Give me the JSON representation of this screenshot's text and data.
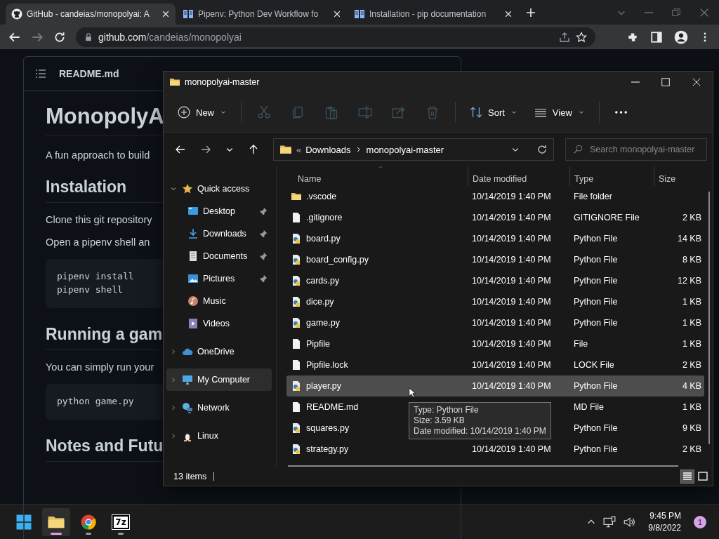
{
  "browser": {
    "tabs": [
      {
        "title": "GitHub - candeias/monopolyai: A",
        "kind": "github",
        "selected": true
      },
      {
        "title": "Pipenv: Python Dev Workflow fo",
        "kind": "doc",
        "selected": false
      },
      {
        "title": "Installation - pip documentation",
        "kind": "doc",
        "selected": false
      }
    ],
    "address": {
      "host": "github.com",
      "path": "/candeias/monopolyai"
    }
  },
  "readme": {
    "file": "README.md",
    "title": "MonopolyA",
    "blocks": [
      {
        "kind": "p",
        "text": "A fun approach to build"
      },
      {
        "kind": "h2",
        "text": "Instalation"
      },
      {
        "kind": "p",
        "text": "Clone this git repository"
      },
      {
        "kind": "p",
        "text": "Open a pipenv shell an"
      },
      {
        "kind": "code",
        "text": "pipenv install\npipenv shell"
      },
      {
        "kind": "h2",
        "text": "Running a gam"
      },
      {
        "kind": "p",
        "text": "You can simply run your"
      },
      {
        "kind": "code",
        "text": "python game.py"
      },
      {
        "kind": "h2",
        "text": "Notes and Futu"
      }
    ]
  },
  "explorer": {
    "title": "monopolyai-master",
    "toolbar": {
      "new": "New",
      "edit_actions_disabled": true,
      "sort": "Sort",
      "view": "View"
    },
    "address": {
      "overflow": "«",
      "segments": [
        "Downloads",
        "monopolyai-master"
      ]
    },
    "search": {
      "placeholder": "Search monopolyai-master"
    },
    "sidebar": [
      {
        "label": "Quick access",
        "kind": "star",
        "expanded": true,
        "selected": false,
        "children": [
          {
            "label": "Desktop",
            "kind": "desktop",
            "pinned": true,
            "selected": false
          },
          {
            "label": "Downloads",
            "kind": "download",
            "pinned": true,
            "selected": false
          },
          {
            "label": "Documents",
            "kind": "document",
            "pinned": true,
            "selected": false
          },
          {
            "label": "Pictures",
            "kind": "pictures",
            "pinned": true,
            "selected": false
          },
          {
            "label": "Music",
            "kind": "music",
            "pinned": false,
            "selected": false
          },
          {
            "label": "Videos",
            "kind": "videos",
            "pinned": false,
            "selected": false
          }
        ]
      },
      {
        "label": "OneDrive",
        "kind": "cloud",
        "expanded": false,
        "selected": false
      },
      {
        "label": "My Computer",
        "kind": "computer",
        "expanded": false,
        "selected": true
      },
      {
        "label": "Network",
        "kind": "network",
        "expanded": false,
        "selected": false
      },
      {
        "label": "Linux",
        "kind": "penguin",
        "expanded": false,
        "selected": false
      }
    ],
    "columns": [
      {
        "label": "Name",
        "sorted": true
      },
      {
        "label": "Date modified",
        "sorted": false
      },
      {
        "label": "Type",
        "sorted": false
      },
      {
        "label": "Size",
        "sorted": false
      }
    ],
    "rows": [
      {
        "name": ".vscode",
        "date": "10/14/2019 1:40 PM",
        "type": "File folder",
        "kind": "folder",
        "selected": false
      },
      {
        "name": ".gitignore",
        "date": "10/14/2019 1:40 PM",
        "type": "GITIGNORE File",
        "size": "2 KB",
        "kind": "file",
        "selected": false
      },
      {
        "name": "board.py",
        "date": "10/14/2019 1:40 PM",
        "type": "Python File",
        "size": "14 KB",
        "kind": "python",
        "selected": false
      },
      {
        "name": "board_config.py",
        "date": "10/14/2019 1:40 PM",
        "type": "Python File",
        "size": "8 KB",
        "kind": "python",
        "selected": false
      },
      {
        "name": "cards.py",
        "date": "10/14/2019 1:40 PM",
        "type": "Python File",
        "size": "12 KB",
        "kind": "python",
        "selected": false
      },
      {
        "name": "dice.py",
        "date": "10/14/2019 1:40 PM",
        "type": "Python File",
        "size": "1 KB",
        "kind": "python",
        "selected": false
      },
      {
        "name": "game.py",
        "date": "10/14/2019 1:40 PM",
        "type": "Python File",
        "size": "1 KB",
        "kind": "python",
        "selected": false
      },
      {
        "name": "Pipfile",
        "date": "10/14/2019 1:40 PM",
        "type": "File",
        "size": "1 KB",
        "kind": "file",
        "selected": false
      },
      {
        "name": "Pipfile.lock",
        "date": "10/14/2019 1:40 PM",
        "type": "LOCK File",
        "size": "2 KB",
        "kind": "file",
        "selected": false
      },
      {
        "name": "player.py",
        "date": "10/14/2019 1:40 PM",
        "type": "Python File",
        "size": "4 KB",
        "kind": "python",
        "selected": true
      },
      {
        "name": "README.md",
        "type": "MD File",
        "size": "1 KB",
        "kind": "file",
        "selected": false
      },
      {
        "name": "squares.py",
        "type": "Python File",
        "size": "9 KB",
        "kind": "python",
        "selected": false
      },
      {
        "name": "strategy.py",
        "date": "10/14/2019 1:40 PM",
        "type": "Python File",
        "size": "2 KB",
        "kind": "python",
        "selected": false
      }
    ],
    "tooltip": {
      "lines": [
        "Type: Python File",
        "Size: 3.59 KB",
        "Date modified: 10/14/2019 1:40 PM"
      ]
    },
    "status": "13 items",
    "view_modes": [
      {
        "kind": "details",
        "selected": true
      },
      {
        "kind": "tiles",
        "selected": false
      }
    ]
  },
  "taskbar": {
    "apps": [
      {
        "kind": "start",
        "running": false,
        "active": false
      },
      {
        "kind": "explorer",
        "running": true,
        "active": true
      },
      {
        "kind": "chrome",
        "running": true,
        "active": false
      },
      {
        "kind": "sevenzip",
        "label": "7z",
        "running": true,
        "active": false
      }
    ],
    "clock": {
      "time": "9:45 PM",
      "date": "9/8/2022"
    },
    "notifications": "1"
  }
}
